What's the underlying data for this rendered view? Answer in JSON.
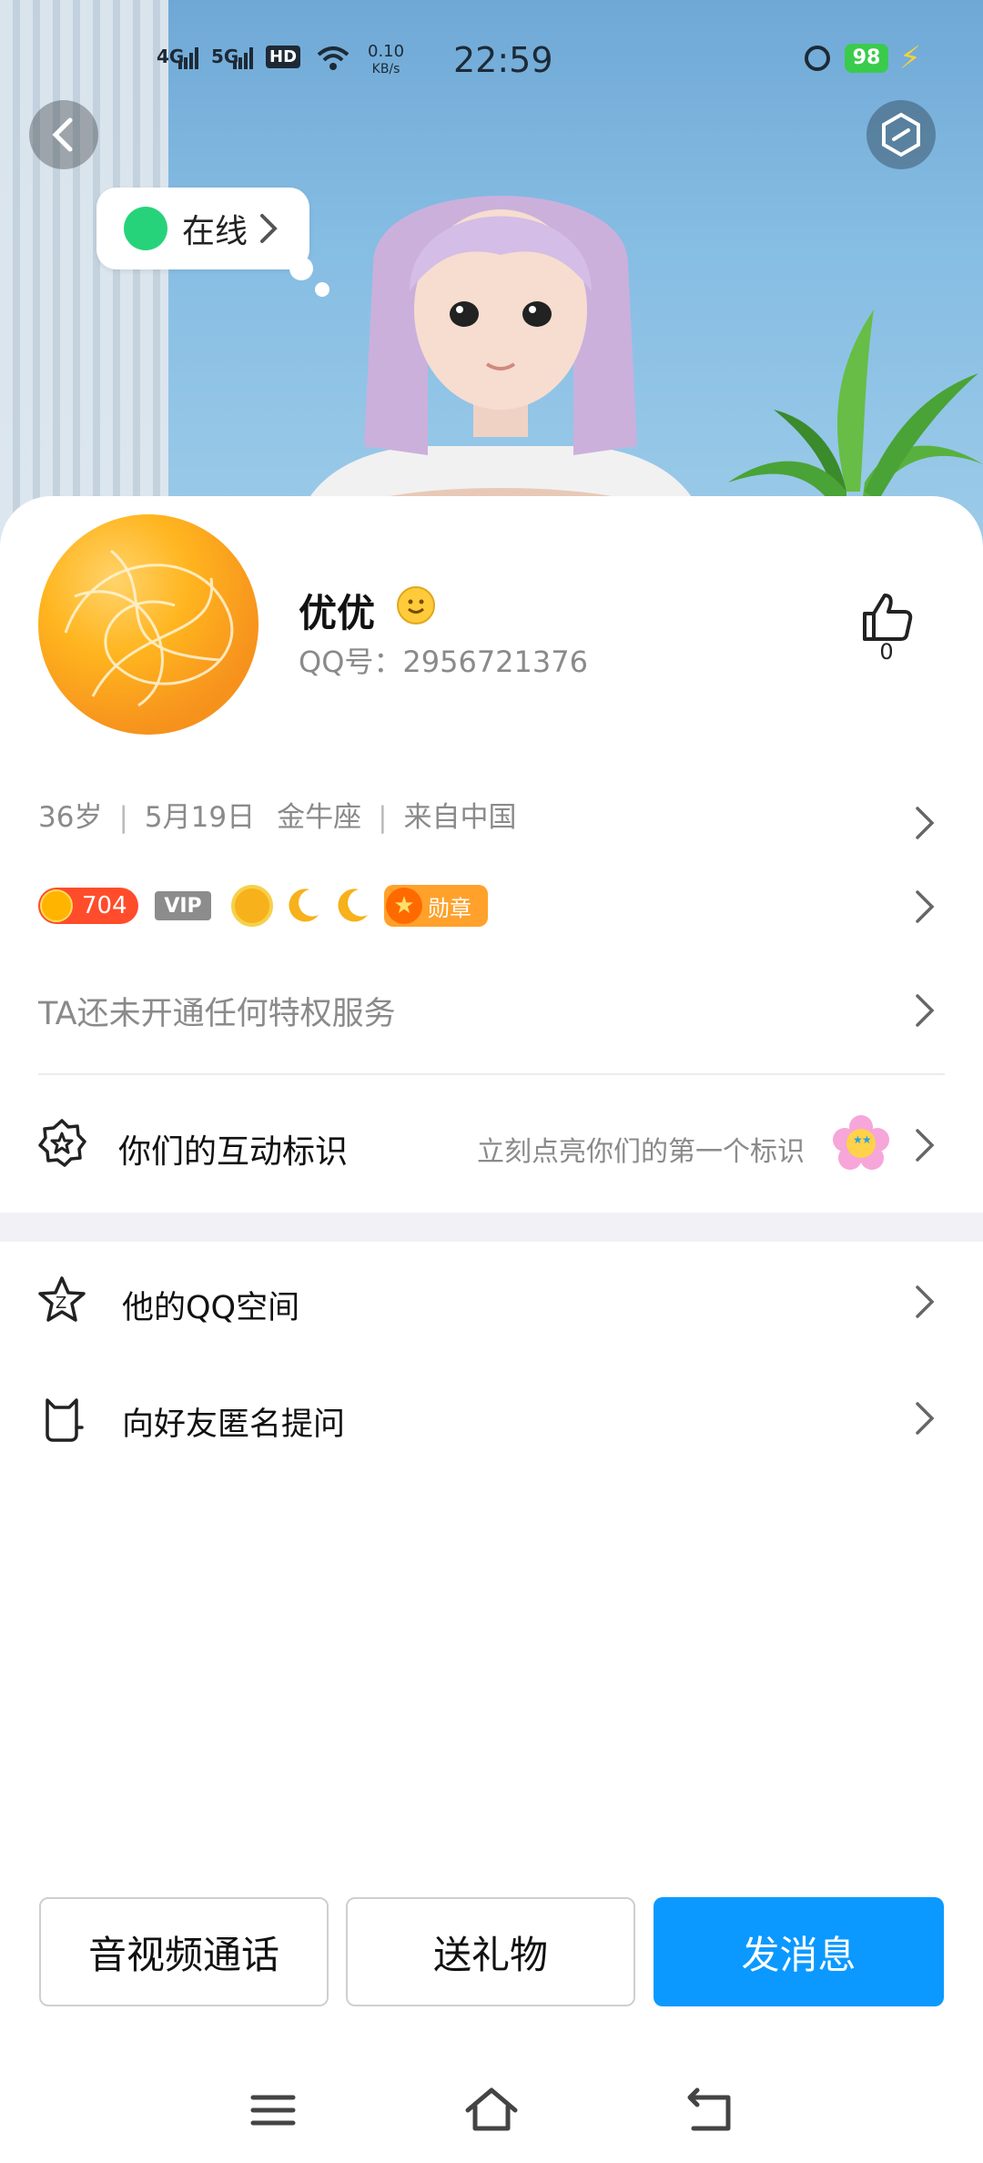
{
  "status_bar": {
    "signal_1": "4G",
    "signal_2": "5G",
    "hd": "HD",
    "net_speed_value": "0.10",
    "net_speed_unit": "KB/s",
    "time": "22:59",
    "battery": "98"
  },
  "online_status": {
    "label": "在线"
  },
  "profile": {
    "name": "优优",
    "qq_number": "QQ号：2956721376",
    "like_count": "0"
  },
  "info": {
    "age": "36岁",
    "birthday": "5月19日",
    "zodiac": "金牛座",
    "location": "来自中国"
  },
  "badges": {
    "level": "704",
    "vip": "VIP",
    "medal": "勋章"
  },
  "privilege_text": "TA还未开通任何特权服务",
  "interaction": {
    "label": "你们的互动标识",
    "hint": "立刻点亮你们的第一个标识"
  },
  "menu": [
    {
      "label": "他的QQ空间"
    },
    {
      "label": "向好友匿名提问"
    }
  ],
  "actions": {
    "call": "音视频通话",
    "gift": "送礼物",
    "message": "发消息"
  },
  "colors": {
    "primary": "#0b99ff",
    "online": "#27d37a",
    "level_badge": "#ff4c2b"
  }
}
